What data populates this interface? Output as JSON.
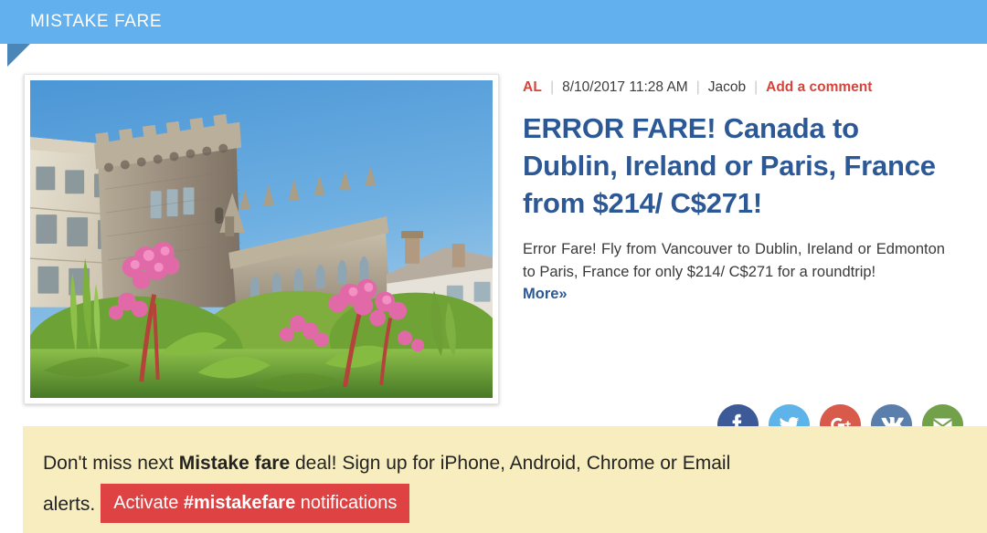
{
  "ribbon": {
    "label": "MISTAKE FARE",
    "color": "#62b1ee",
    "fold_color": "#4a87b8"
  },
  "article": {
    "meta": {
      "tag": "AL",
      "separator": "|",
      "date": "8/10/2017 11:28 AM",
      "author": "Jacob",
      "comment_link": "Add a comment",
      "accent_color": "#d6443c"
    },
    "headline": "ERROR FARE! Canada to Dublin, Ireland or Paris, France from $214/ C$271!",
    "headline_color": "#2c5896",
    "excerpt": "Error Fare! Fly from Vancouver to Dublin, Ireland or Edmonton to Paris, France for only $214/ C$271 for a roundtrip!",
    "more_label": "More",
    "more_chevron": "»",
    "photo_alt": "Dublin Castle Record Tower and Chapel Royal behind a garden of pink bergenia flowers under a blue sky"
  },
  "social": [
    {
      "name": "facebook",
      "label": "Share on Facebook",
      "color": "#3d5a98"
    },
    {
      "name": "twitter",
      "label": "Share on Twitter",
      "color": "#5eb4e8"
    },
    {
      "name": "googleplus",
      "label": "Share on Google Plus",
      "color": "#d75a4a"
    },
    {
      "name": "vk",
      "label": "Share on VK",
      "color": "#5a7fac"
    },
    {
      "name": "email",
      "label": "Share by Email",
      "color": "#72a04b"
    }
  ],
  "signup": {
    "line1_pre": "Don't miss next ",
    "line1_bold": "Mistake fare",
    "line1_post": " deal! Sign up for iPhone, Android, Chrome or Email",
    "line2": "alerts.",
    "cta_pre": "Activate ",
    "cta_bold": "#mistakefare",
    "cta_post": " notifications",
    "background_color": "#f7edbe",
    "cta_color": "#df4242"
  }
}
